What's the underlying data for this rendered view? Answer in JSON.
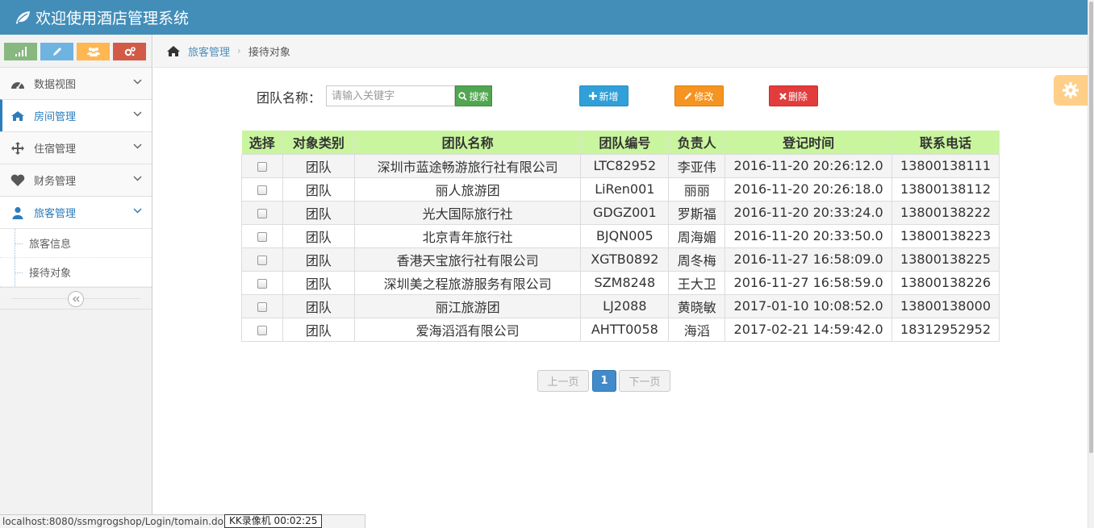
{
  "header": {
    "title": "欢迎使用酒店管理系统",
    "logo_icon": "leaf-icon"
  },
  "sidebar": {
    "shortcuts": [
      {
        "icon": "signal-icon",
        "color": "#87b87f"
      },
      {
        "icon": "pencil-icon",
        "color": "#6fb3e0"
      },
      {
        "icon": "users-icon",
        "color": "#ffb752"
      },
      {
        "icon": "cogs-icon",
        "color": "#d15b47"
      }
    ],
    "items": [
      {
        "label": "数据视图",
        "icon": "dashboard-icon"
      },
      {
        "label": "房间管理",
        "icon": "home-icon"
      },
      {
        "label": "住宿管理",
        "icon": "move-icon"
      },
      {
        "label": "财务管理",
        "icon": "heart-icon"
      },
      {
        "label": "旅客管理",
        "icon": "user-icon"
      }
    ],
    "submenu": [
      {
        "label": "旅客信息"
      },
      {
        "label": "接待对象"
      }
    ]
  },
  "breadcrumb": {
    "parent": "旅客管理",
    "current": "接待对象"
  },
  "search": {
    "label": "团队名称：",
    "placeholder": "请输入关键字",
    "button": "搜索"
  },
  "actions": {
    "add": "新增",
    "edit": "修改",
    "delete": "删除"
  },
  "table": {
    "headers": [
      "选择",
      "对象类别",
      "团队名称",
      "团队编号",
      "负责人",
      "登记时间",
      "联系电话"
    ],
    "rows": [
      {
        "type": "团队",
        "name": "深圳市蓝途畅游旅行社有限公司",
        "code": "LTC82952",
        "leader": "李亚伟",
        "time": "2016-11-20 20:26:12.0",
        "phone": "13800138111"
      },
      {
        "type": "团队",
        "name": "丽人旅游团",
        "code": "LiRen001",
        "leader": "丽丽",
        "time": "2016-11-20 20:26:18.0",
        "phone": "13800138112"
      },
      {
        "type": "团队",
        "name": "光大国际旅行社",
        "code": "GDGZ001",
        "leader": "罗斯福",
        "time": "2016-11-20 20:33:24.0",
        "phone": "13800138222"
      },
      {
        "type": "团队",
        "name": "北京青年旅行社",
        "code": "BJQN005",
        "leader": "周海媚",
        "time": "2016-11-20 20:33:50.0",
        "phone": "13800138223"
      },
      {
        "type": "团队",
        "name": "香港天宝旅行社有限公司",
        "code": "XGTB0892",
        "leader": "周冬梅",
        "time": "2016-11-27 16:58:09.0",
        "phone": "13800138225"
      },
      {
        "type": "团队",
        "name": "深圳美之程旅游服务有限公司",
        "code": "SZM8248",
        "leader": "王大卫",
        "time": "2016-11-27 16:58:59.0",
        "phone": "13800138226"
      },
      {
        "type": "团队",
        "name": "丽江旅游团",
        "code": "LJ2088",
        "leader": "黄晓敏",
        "time": "2017-01-10 10:08:52.0",
        "phone": "13800138000"
      },
      {
        "type": "团队",
        "name": "爱海滔滔有限公司",
        "code": "AHTT0058",
        "leader": "海滔",
        "time": "2017-02-21 14:59:42.0",
        "phone": "18312952952"
      }
    ]
  },
  "pagination": {
    "prev": "上一页",
    "current": "1",
    "next": "下一页"
  },
  "status": {
    "url": "localhost:8080/ssmgrogshop/Login/tomain.do#",
    "recorder": "KK录像机 00:02:25"
  }
}
